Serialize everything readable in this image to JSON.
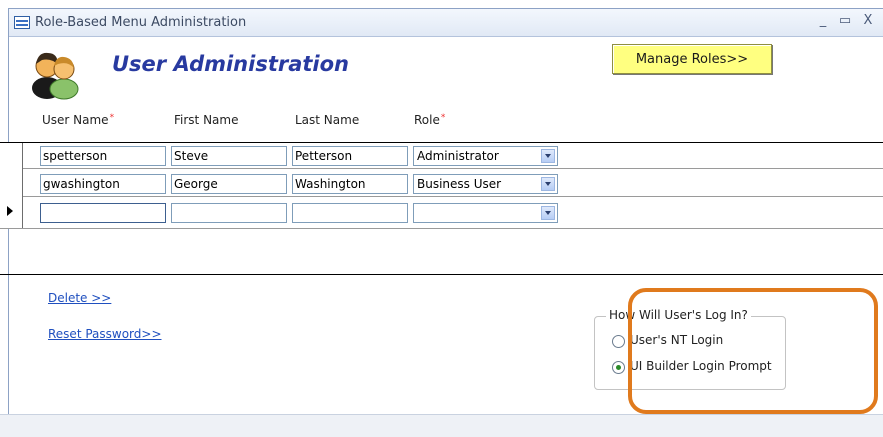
{
  "window": {
    "title": "Role-Based Menu Administration",
    "minimize": "_",
    "maximize": "▭",
    "close": "X"
  },
  "header": {
    "title": "User Administration",
    "icon": "users-icon",
    "manage_roles_label": "Manage Roles>>"
  },
  "columns": [
    {
      "label": "User Name",
      "required": "*"
    },
    {
      "label": "First Name",
      "required": ""
    },
    {
      "label": "Last Name",
      "required": ""
    },
    {
      "label": "Role",
      "required": "*"
    }
  ],
  "rows": [
    {
      "user_name": "spetterson",
      "first_name": "Steve",
      "last_name": "Petterson",
      "role": "Administrator"
    },
    {
      "user_name": "gwashington",
      "first_name": "George",
      "last_name": "Washington",
      "role": "Business User"
    },
    {
      "user_name": "",
      "first_name": "",
      "last_name": "",
      "role": ""
    }
  ],
  "actions": {
    "delete_label": "Delete  >>",
    "reset_password_label": "Reset Password>>"
  },
  "login_group": {
    "legend": "How Will User's Log In?",
    "options": [
      {
        "label": "User's NT Login",
        "selected": false
      },
      {
        "label": "UI Builder Login Prompt",
        "selected": true
      }
    ]
  },
  "colors": {
    "title_color": "#283aa0",
    "button_yellow": "#ffff80",
    "highlight_orange": "#e07a1d",
    "link_blue": "#1f4fbf"
  }
}
